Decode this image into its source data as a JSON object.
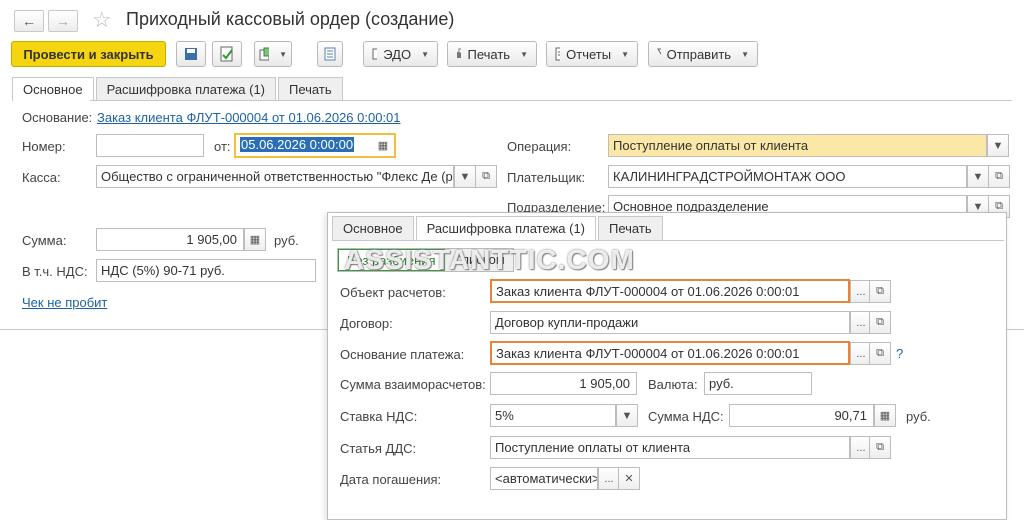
{
  "window": {
    "title": "Приходный кассовый ордер (создание)"
  },
  "toolbar": {
    "post_close": "Провести и закрыть",
    "edo": "ЭДО",
    "print": "Печать",
    "reports": "Отчеты",
    "send": "Отправить"
  },
  "main_tabs": [
    "Основное",
    "Расшифровка платежа (1)",
    "Печать"
  ],
  "form": {
    "basis_label": "Основание:",
    "basis_link": "Заказ клиента ФЛУТ-000004 от 01.06.2026 0:00:01",
    "number_label": "Номер:",
    "number_value": "",
    "from_label": "от:",
    "date_value": "05.06.2026  0:00:00",
    "operation_label": "Операция:",
    "operation_value": "Поступление оплаты от клиента",
    "cash_label": "Касса:",
    "cash_value": "Общество с ограниченной ответственностью \"Флекс Де (р",
    "payer_label": "Плательщик:",
    "payer_value": "КАЛИНИНГРАДСТРОЙМОНТАЖ ООО",
    "division_label": "Подразделение:",
    "division_value": "Основное подразделение",
    "sum_label": "Сумма:",
    "sum_value": "1 905,00",
    "currency": "руб.",
    "vat_label": "В т.ч. НДС:",
    "vat_value": "НДС (5%) 90-71 руб.",
    "check_link": "Чек не пробит"
  },
  "overlay": {
    "tabs": [
      "Основное",
      "Расшифровка платежа (1)",
      "Печать"
    ],
    "toggle": {
      "no_split": "Без разбиения",
      "list": "Списком"
    },
    "watermark": "ASSISTANTTIC.COM",
    "object_label": "Объект расчетов:",
    "object_value": "Заказ клиента ФЛУТ-000004 от 01.06.2026 0:00:01",
    "contract_label": "Договор:",
    "contract_value": "Договор купли-продажи",
    "payment_basis_label": "Основание платежа:",
    "payment_basis_value": "Заказ клиента ФЛУТ-000004 от 01.06.2026 0:00:01",
    "settlement_label": "Сумма взаиморасчетов:",
    "settlement_value": "1 905,00",
    "currency_label": "Валюта:",
    "currency_value": "руб.",
    "vat_rate_label": "Ставка НДС:",
    "vat_rate_value": "5%",
    "vat_sum_label": "Сумма НДС:",
    "vat_sum_value": "90,71",
    "vat_sum_unit": "руб.",
    "cashflow_label": "Статья ДДС:",
    "cashflow_value": "Поступление оплаты от клиента",
    "due_label": "Дата погашения:",
    "due_value": "<автоматически>",
    "help": "?"
  }
}
